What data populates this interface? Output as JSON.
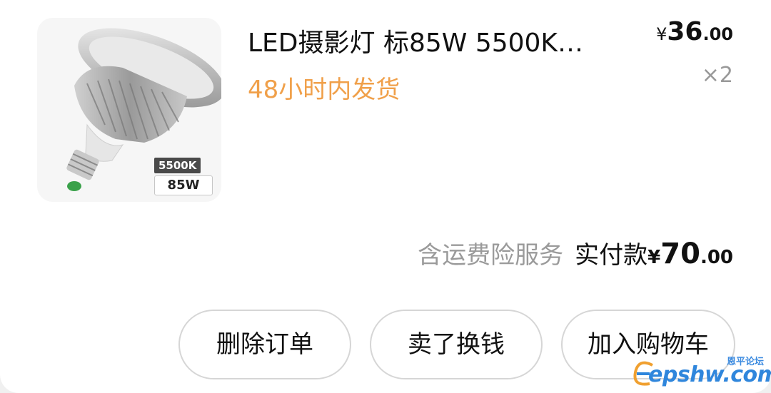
{
  "product": {
    "title": "LED摄影灯 标85W 5500K…",
    "shipping": "48小时内发货",
    "badge_temp": "5500K",
    "badge_power": "85W",
    "price": {
      "currency": "¥",
      "integer": "36",
      "decimal": ".00"
    },
    "quantity": "×2"
  },
  "total": {
    "note": "含运费险服务",
    "label": "实付款",
    "currency": "¥",
    "integer": "70",
    "decimal": ".00"
  },
  "actions": {
    "delete": "删除订单",
    "sell": "卖了换钱",
    "add_to_cart": "加入购物车"
  },
  "watermark": {
    "small": "恩平论坛",
    "main": "epshw.com"
  },
  "colors": {
    "shipping": "#f0a04a",
    "muted": "#9a9a9a",
    "border": "#d6d6d6",
    "watermark": "#2f86dc"
  }
}
